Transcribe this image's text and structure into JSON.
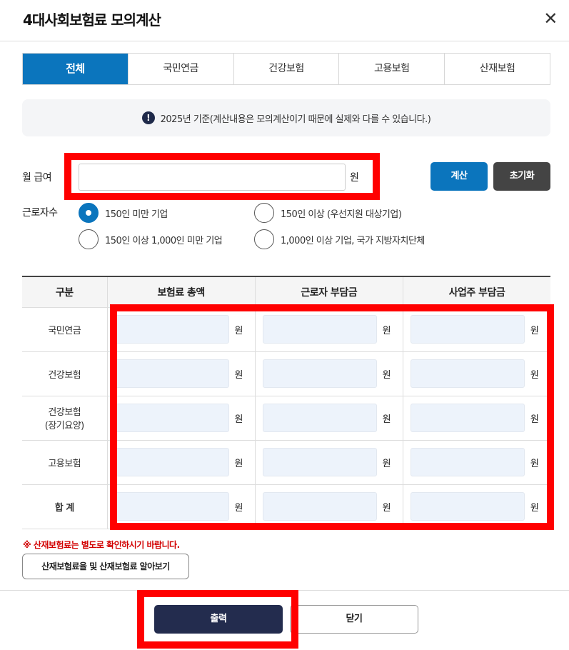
{
  "header": {
    "title": "4대사회보험료 모의계산",
    "close_icon": "close-icon"
  },
  "tabs": [
    {
      "label": "전체",
      "active": true
    },
    {
      "label": "국민연금",
      "active": false
    },
    {
      "label": "건강보험",
      "active": false
    },
    {
      "label": "고용보험",
      "active": false
    },
    {
      "label": "산재보험",
      "active": false
    }
  ],
  "notice": {
    "icon": "!",
    "text": "2025년 기준(계산내용은 모의계산이기 때문에 실제와 다를 수 있습니다.)"
  },
  "salary": {
    "label": "월 급여",
    "value": "",
    "unit": "원"
  },
  "buttons": {
    "calc": "계산",
    "reset": "초기화"
  },
  "workers": {
    "label": "근로자수",
    "options": [
      {
        "label": "150인 미만 기업",
        "checked": true
      },
      {
        "label": "150인 이상 (우선지원 대상기업)",
        "checked": false
      },
      {
        "label": "150인 이상 1,000인 미만 기업",
        "checked": false
      },
      {
        "label": "1,000인 이상 기업, 국가 지방자치단체",
        "checked": false
      }
    ]
  },
  "table": {
    "headers": [
      "구분",
      "보험료 총액",
      "근로자 부담금",
      "사업주 부담금"
    ],
    "unit": "원",
    "rows": [
      {
        "label": "국민연금"
      },
      {
        "label": "건강보험"
      },
      {
        "label": "건강보험",
        "label2": "(장기요양)"
      },
      {
        "label": "고용보험"
      },
      {
        "label": "합 계"
      }
    ]
  },
  "warning": "※ 산재보험료는 별도로 확인하시기 바랍니다.",
  "link_button": "산재보험료율 및 산재보험료 알아보기",
  "footer": {
    "print": "출력",
    "close": "닫기"
  },
  "colors": {
    "accent": "#0b75bd",
    "dark": "#232c4e",
    "highlight": "#ff0000",
    "warning": "#d20000"
  }
}
